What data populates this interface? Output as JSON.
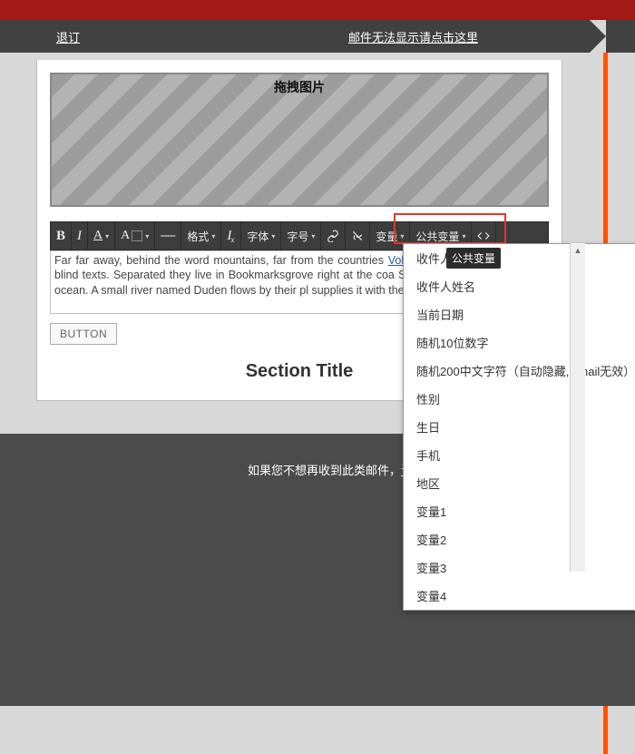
{
  "colors": {
    "red_bar": "#a31917",
    "orange_strip": "#ff5200",
    "highlight": "#e63428"
  },
  "ribbon": {
    "left": "退订",
    "right": "邮件无法显示请点击这里"
  },
  "image_drop": {
    "label": "拖拽图片"
  },
  "toolbar": {
    "bold": "B",
    "italic": "I",
    "font_color": "A",
    "bg_color": "A",
    "format": "格式",
    "clear_fmt": "I",
    "font_family": "字体",
    "font_size": "字号",
    "var": "变量",
    "public_var": "公共变量"
  },
  "tooltip": {
    "public_var": "公共变量"
  },
  "editor": {
    "text_pre": "Far far away, behind the word mountains, far from the countries ",
    "link": "Vokalia and Con",
    "text_post": " there live the blind texts. Separated they live in Bookmarksgrove right at the coa Semantics, a large language ocean. A small river named Duden flows by their pl supplies it with the necessary regelialia."
  },
  "button": {
    "label": "BUTTON"
  },
  "section_title": "Section Title",
  "footer": {
    "prefix": "如果您不想再收到此类邮件，",
    "link": "请"
  },
  "dropdown": {
    "items": [
      "收件人地",
      "收件人姓名",
      "当前日期",
      "随机10位数字",
      "随机200中文字符（自动隐藏,Gmail无效）",
      "性别",
      "生日",
      "手机",
      "地区",
      "变量1",
      "变量2",
      "变量3",
      "变量4"
    ]
  }
}
